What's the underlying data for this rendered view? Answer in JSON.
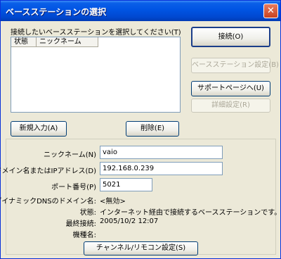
{
  "window": {
    "title": "ベースステーションの選択",
    "close_glyph": "✕"
  },
  "list": {
    "label": "接続したいベースステーションを選択してください(T)",
    "columns": [
      "状態",
      "ニックネーム"
    ]
  },
  "buttons": {
    "connect": "接続(O)",
    "base_settings": "ベースステーション設定(B)",
    "support_page": "サポートページへ(U)",
    "details": "詳細設定(R)",
    "new_entry": "新規入力(A)",
    "delete": "削除(E)",
    "channel_remote": "チャンネル/リモコン設定(S)"
  },
  "form": {
    "nickname_label": "ニックネーム(N)",
    "nickname_value": "vaio",
    "domain_label": "ドメイン名またはIPアドレス(D)",
    "domain_value": "192.168.0.239",
    "port_label": "ポート番号(P)",
    "port_value": "5021",
    "dyndns_label": "ダイナミックDNSのドメイン名:",
    "dyndns_value": "<無効>",
    "status_label": "状態:",
    "status_value": "インターネット経由で接続するベースステーションです。",
    "last_label": "最終接続:",
    "last_value": "2005/10/2 12:07",
    "model_label": "機種名:",
    "model_value": ""
  },
  "colors": {
    "titlebar": "#0054e3",
    "dialog_bg": "#ece9d8",
    "input_border": "#7f9db9"
  }
}
